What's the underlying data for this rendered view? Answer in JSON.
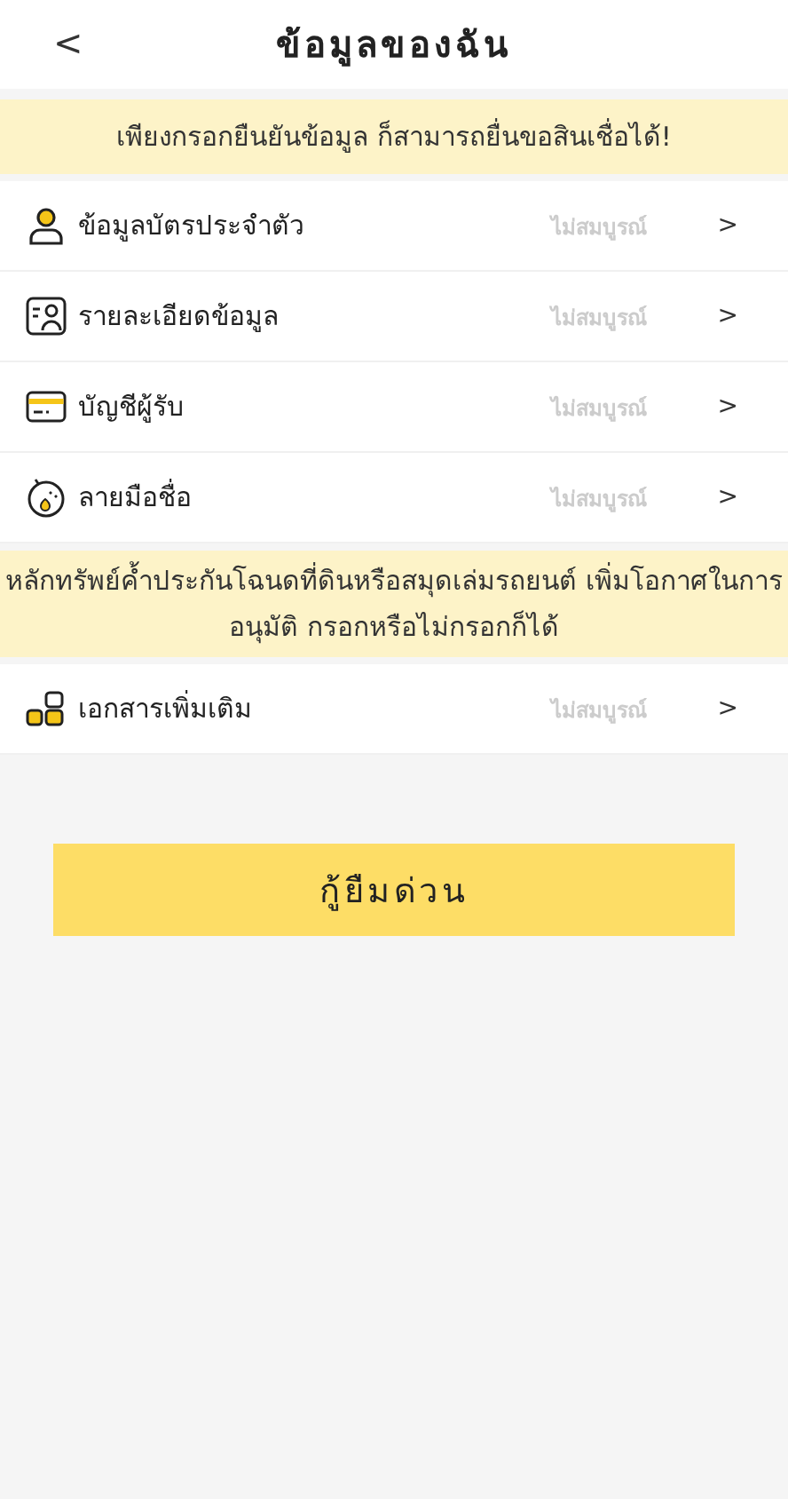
{
  "header": {
    "back": "<",
    "title": "ข้อมูลของฉัน"
  },
  "notice": "เพียงกรอกยืนยันข้อมูล ก็สามารถยื่นขอสินเชื่อได้!",
  "required_items": [
    {
      "kind": "person",
      "label": "ข้อมูลบัตรประจำตัว",
      "status": "ไม่สมบูรณ์",
      "arrow": ">"
    },
    {
      "kind": "profile",
      "label": "รายละเอียดข้อมูล",
      "status": "ไม่สมบูรณ์",
      "arrow": ">"
    },
    {
      "kind": "card",
      "label": "บัญชีผู้รับ",
      "status": "ไม่สมบูรณ์",
      "arrow": ">"
    },
    {
      "kind": "signature",
      "label": "ลายมือชื่อ",
      "status": "ไม่สมบูรณ์",
      "arrow": ">"
    }
  ],
  "collateral_notice": "หลักทรัพย์ค้ำประกันโฉนดที่ดินหรือสมุดเล่มรถยนต์ เพิ่มโอกาศในการอนุมัติ กรอกหรือไม่กรอกก็ได้",
  "optional_items": [
    {
      "kind": "documents",
      "label": "เอกสารเพิ่มเติม",
      "status": "ไม่สมบูรณ์",
      "arrow": ">"
    }
  ],
  "submit_button": "กู้ยืมด่วน"
}
